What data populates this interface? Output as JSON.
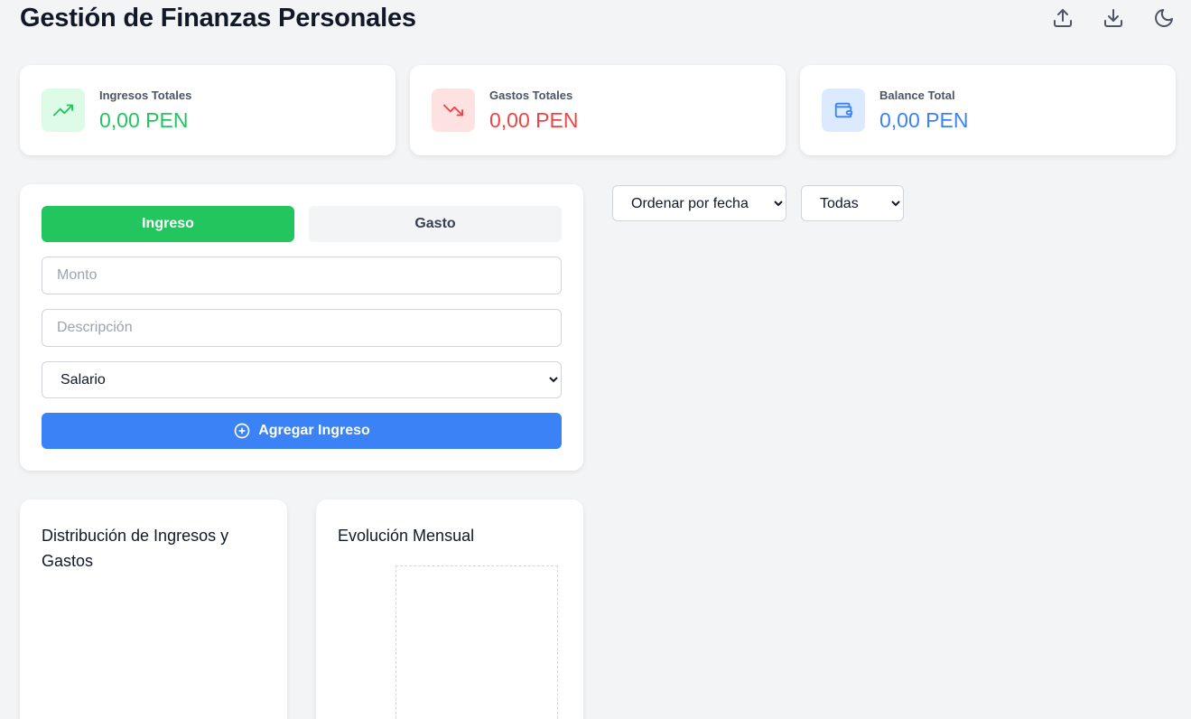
{
  "header": {
    "title": "Gestión de Finanzas Personales",
    "icons": [
      "upload-icon",
      "download-icon",
      "moon-icon"
    ]
  },
  "stats": {
    "income": {
      "label": "Ingresos Totales",
      "value": "0,00 PEN",
      "color": "#22c55e",
      "bg": "#dcfce7",
      "icon": "trending-up-icon"
    },
    "expenses": {
      "label": "Gastos Totales",
      "value": "0,00 PEN",
      "color": "#ef4444",
      "bg": "#fee2e2",
      "icon": "trending-down-icon"
    },
    "balance": {
      "label": "Balance Total",
      "value": "0,00 PEN",
      "color": "#3b82f6",
      "bg": "#dbeafe",
      "icon": "wallet-icon"
    }
  },
  "form": {
    "tabs": {
      "income": "Ingreso",
      "expense": "Gasto"
    },
    "amount_placeholder": "Monto",
    "description_placeholder": "Descripción",
    "category_selected": "Salario",
    "submit_label": "Agregar Ingreso"
  },
  "filters": {
    "sort_selected": "Ordenar por fecha",
    "type_selected": "Todas"
  },
  "charts": {
    "distribution_title": "Distribución de Ingresos y Gastos",
    "monthly_title": "Evolución Mensual"
  },
  "colors": {
    "accent_green": "#22c55e",
    "accent_blue": "#3b82f6",
    "accent_red": "#ef4444"
  }
}
